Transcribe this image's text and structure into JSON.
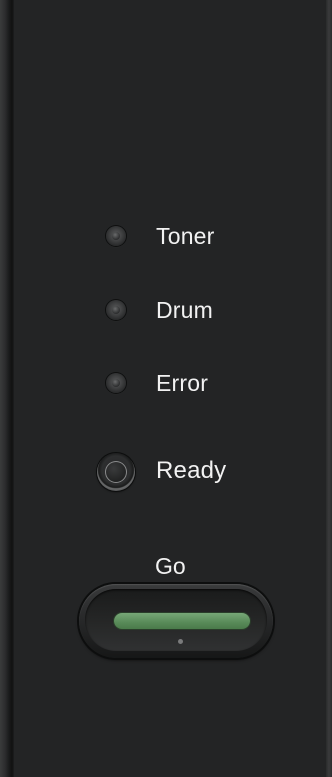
{
  "indicators": [
    {
      "name": "toner",
      "label": "Toner"
    },
    {
      "name": "drum",
      "label": "Drum"
    },
    {
      "name": "error",
      "label": "Error"
    },
    {
      "name": "ready",
      "label": "Ready"
    }
  ],
  "go_button": {
    "label": "Go",
    "light_color": "#5f915f"
  },
  "colors": {
    "panel": "#232425",
    "text": "#f2f2f2"
  },
  "icons": {
    "led": "led-indicator-icon",
    "go_light": "go-light-indicator"
  }
}
